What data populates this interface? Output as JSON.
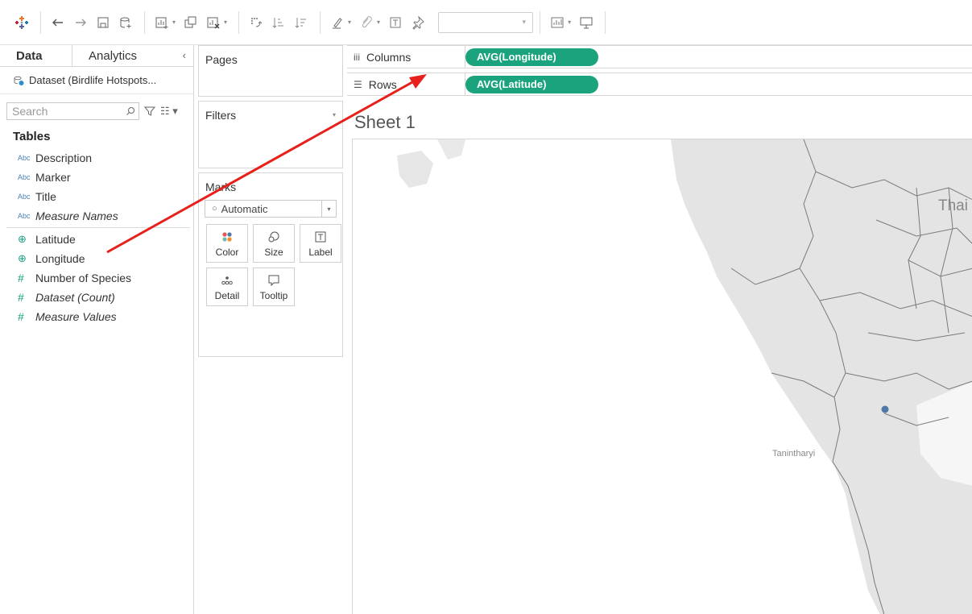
{
  "data_pane": {
    "tabs": [
      {
        "label": "Data",
        "active": true
      },
      {
        "label": "Analytics",
        "active": false
      }
    ],
    "collapse_glyph": "‹",
    "datasource": "Dataset (Birdlife Hotspots...",
    "search_placeholder": "Search",
    "tables_heading": "Tables",
    "dimensions": [
      {
        "type": "Abc",
        "name": "Description",
        "italic": false
      },
      {
        "type": "Abc",
        "name": "Marker",
        "italic": false
      },
      {
        "type": "Abc",
        "name": "Title",
        "italic": false
      },
      {
        "type": "Abc",
        "name": "Measure Names",
        "italic": true
      }
    ],
    "measures": [
      {
        "type": "geo",
        "name": "Latitude",
        "italic": false
      },
      {
        "type": "geo",
        "name": "Longitude",
        "italic": false
      },
      {
        "type": "#",
        "name": "Number of Species",
        "italic": false
      },
      {
        "type": "#",
        "name": "Dataset (Count)",
        "italic": true
      },
      {
        "type": "#",
        "name": "Measure Values",
        "italic": true
      }
    ]
  },
  "pages": {
    "title": "Pages"
  },
  "filters": {
    "title": "Filters"
  },
  "marks": {
    "title": "Marks",
    "type": "Automatic",
    "buttons": [
      {
        "label": "Color",
        "icon": "color-icon"
      },
      {
        "label": "Size",
        "icon": "size-icon"
      },
      {
        "label": "Label",
        "icon": "label-icon"
      },
      {
        "label": "Detail",
        "icon": "detail-icon"
      },
      {
        "label": "Tooltip",
        "icon": "tooltip-icon"
      }
    ]
  },
  "shelves": {
    "columns": {
      "label": "Columns",
      "pill": "AVG(Longitude)"
    },
    "rows": {
      "label": "Rows",
      "pill": "AVG(Latitude)"
    }
  },
  "sheet": {
    "title": "Sheet 1"
  },
  "map": {
    "labels": {
      "country": "Thai",
      "region": "Tanintharyi"
    },
    "point_color": "#4e79a7"
  },
  "colors": {
    "pill": "#1aa37c",
    "annotation_arrow": "#e8201c"
  }
}
